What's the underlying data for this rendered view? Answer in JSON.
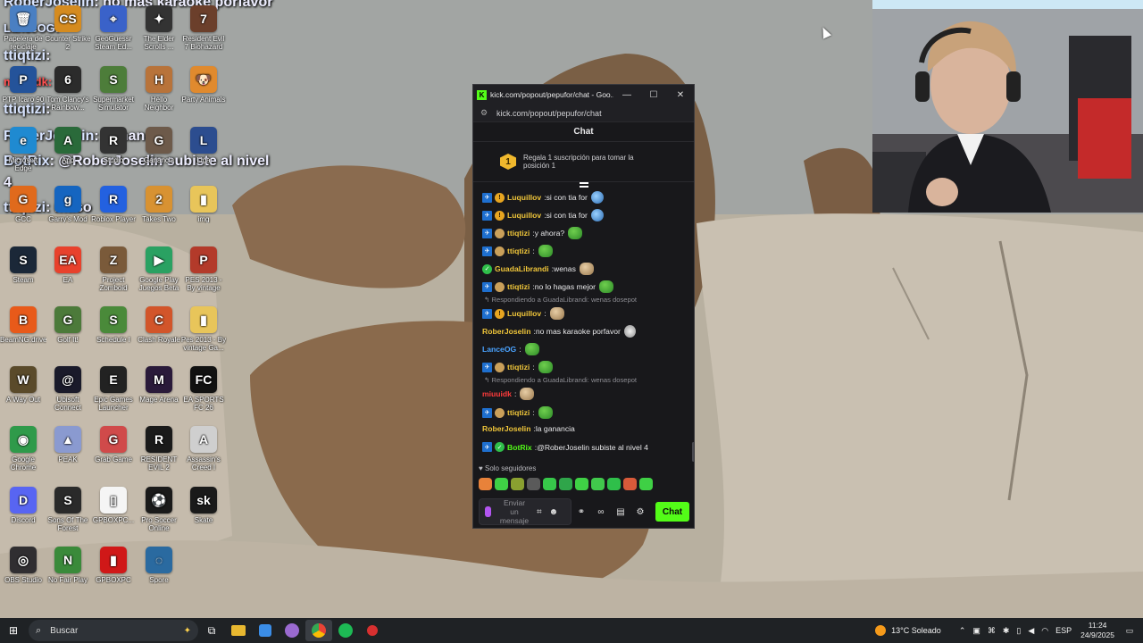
{
  "overlay_chat": [
    {
      "user": "RoberJoselin",
      "text": "no mas karaoke porfavor"
    },
    {
      "user": "LanceOG",
      "text": ""
    },
    {
      "user": "ttiqtizi",
      "text": ""
    },
    {
      "user": "miuuidk",
      "text": ""
    },
    {
      "user": "ttiqtizi",
      "text": ""
    },
    {
      "user": "RoberJoselin",
      "text": "ganancia"
    },
    {
      "user": "BotRix",
      "text": "@RoberJoselin subiste al nivel"
    },
    {
      "user": "",
      "text": "4"
    },
    {
      "user": "ttiqtizi",
      "text": "maso"
    }
  ],
  "desktop_icons": [
    {
      "label": "Papelera de reciclaje",
      "color": "#4a7fc2",
      "glyph": "🗑"
    },
    {
      "label": "Counter Strike 2",
      "color": "#d58b1f",
      "glyph": "CS"
    },
    {
      "label": "GeoGuessr Steam Ed...",
      "color": "#3a62c9",
      "glyph": "⌖"
    },
    {
      "label": "The Elder Scrolls ...",
      "color": "#333333",
      "glyph": "✦"
    },
    {
      "label": "Resident Evil 7 Biohazard",
      "color": "#6b3f2b",
      "glyph": "7"
    },
    {
      "label": "PTP Icaro 90",
      "color": "#24539a",
      "glyph": "P"
    },
    {
      "label": "Tom Clancy's Rainbow...",
      "color": "#2b2b2b",
      "glyph": "6"
    },
    {
      "label": "Supermarket Simulator",
      "color": "#4d7d3a",
      "glyph": "S"
    },
    {
      "label": "Hello Neighbor",
      "color": "#b8733a",
      "glyph": "H"
    },
    {
      "label": "Party Animals",
      "color": "#e08a2e",
      "glyph": "🐶"
    },
    {
      "label": "Microsoft Edge",
      "color": "#1f8ad1",
      "glyph": "e"
    },
    {
      "label": "App",
      "color": "#2a6a3a",
      "glyph": "A"
    },
    {
      "label": "Studio",
      "color": "#333333",
      "glyph": "R"
    },
    {
      "label": "Ganancia",
      "color": "#6d5a4a",
      "glyph": "G"
    },
    {
      "label": "Liga",
      "color": "#2c4d8f",
      "glyph": "L"
    },
    {
      "label": "GCC",
      "color": "#e06a1c",
      "glyph": "G"
    },
    {
      "label": "Garry's Mod",
      "color": "#1565c0",
      "glyph": "g"
    },
    {
      "label": "Roblox Player",
      "color": "#2361e0",
      "glyph": "R"
    },
    {
      "label": "Takes Two",
      "color": "#d89232",
      "glyph": "2"
    },
    {
      "label": "img",
      "color": "#e8c55a",
      "glyph": "▮"
    },
    {
      "label": "Steam",
      "color": "#1b2838",
      "glyph": "S"
    },
    {
      "label": "EA",
      "color": "#e8412c",
      "glyph": "EA"
    },
    {
      "label": "Project Zomboid",
      "color": "#7a5a3a",
      "glyph": "Z"
    },
    {
      "label": "Google Play Juegos Beta",
      "color": "#2aa162",
      "glyph": "▶"
    },
    {
      "label": "PES 2013 - By vintage Ga...",
      "color": "#b33a2a",
      "glyph": "P"
    },
    {
      "label": "BeamNG.drive",
      "color": "#e85a1a",
      "glyph": "B"
    },
    {
      "label": "Golf It!",
      "color": "#4c7a3a",
      "glyph": "G"
    },
    {
      "label": "Schedule I",
      "color": "#4a8a3a",
      "glyph": "S"
    },
    {
      "label": "Clash Royale",
      "color": "#d2552a",
      "glyph": "C"
    },
    {
      "label": "Pes 2013 - By vintage Ga...",
      "color": "#e8c55a",
      "glyph": "▮"
    },
    {
      "label": "A Way Out",
      "color": "#5a4a2a",
      "glyph": "W"
    },
    {
      "label": "Ubisoft Connect",
      "color": "#1a1a2a",
      "glyph": "@"
    },
    {
      "label": "Epic Games Launcher",
      "color": "#222222",
      "glyph": "E"
    },
    {
      "label": "Mage Arena",
      "color": "#2a1a3a",
      "glyph": "M"
    },
    {
      "label": "EA SPORTS FC 26",
      "color": "#111111",
      "glyph": "FC"
    },
    {
      "label": "Google Chrome",
      "color": "#2f9a4a",
      "glyph": "◉"
    },
    {
      "label": "PEAK",
      "color": "#8a9ad0",
      "glyph": "▲"
    },
    {
      "label": "Grab Game",
      "color": "#d04a4a",
      "glyph": "G"
    },
    {
      "label": "RESIDENT EVIL 2",
      "color": "#1a1a1a",
      "glyph": "R"
    },
    {
      "label": "Assassin's Creed I",
      "color": "#cfcfcf",
      "glyph": "A"
    },
    {
      "label": "Discord",
      "color": "#5865f2",
      "glyph": "D"
    },
    {
      "label": "Sons Of The Forest",
      "color": "#2a2a2a",
      "glyph": "S"
    },
    {
      "label": "GPBOXPC...",
      "color": "#f5f5f5",
      "glyph": "▯"
    },
    {
      "label": "Pro Soccer Online",
      "color": "#1a1a1a",
      "glyph": "⚽"
    },
    {
      "label": "Skate",
      "color": "#1a1a1a",
      "glyph": "sk"
    },
    {
      "label": "OBS Studio",
      "color": "#302e31",
      "glyph": "◎"
    },
    {
      "label": "No Fair Play",
      "color": "#3a8a3a",
      "glyph": "N"
    },
    {
      "label": "GPBOXPC",
      "color": "#d01818",
      "glyph": "▮"
    },
    {
      "label": "Spore",
      "color": "#2a6aa0",
      "glyph": "◌"
    }
  ],
  "popup": {
    "title": "kick.com/popout/pepufor/chat - Goo...",
    "url": "kick.com/popout/pepufor/chat",
    "header": "Chat",
    "promo_text": "Regala 1 suscripción para tomar la posición 1",
    "promo_rank": "1",
    "messages": [
      {
        "type": "msg",
        "badges": [
          "bot",
          "sub"
        ],
        "user": "Luquillov",
        "color": "#f0c63a",
        "text": "si con tia for",
        "emote": "globe"
      },
      {
        "type": "msg",
        "badges": [
          "bot",
          "sub"
        ],
        "user": "Luquillov",
        "color": "#f0c63a",
        "text": "si con tia for",
        "emote": "globe"
      },
      {
        "type": "msg",
        "badges": [
          "bot",
          "gift"
        ],
        "user": "ttiqtizi",
        "color": "#f0c63a",
        "text": "y ahora?",
        "emote": "pepe"
      },
      {
        "type": "msg",
        "badges": [
          "bot",
          "gift"
        ],
        "user": "ttiqtizi",
        "color": "#f0c63a",
        "text": "",
        "emote": "pepe"
      },
      {
        "type": "msg",
        "badges": [
          "mod"
        ],
        "user": "GuadaLibrandi",
        "color": "#f0c63a",
        "text": "wenas",
        "emote": "dog"
      },
      {
        "type": "msg",
        "badges": [
          "bot",
          "gift"
        ],
        "user": "ttiqtizi",
        "color": "#f0c63a",
        "text": "no lo hagas mejor",
        "emote": "pepe"
      },
      {
        "type": "reply",
        "text": "Respondiendo a GuadaLibrandi: wenas dosepot"
      },
      {
        "type": "msg",
        "badges": [
          "bot",
          "sub"
        ],
        "user": "Luquillov",
        "color": "#f0c63a",
        "text": "",
        "emote": "dog"
      },
      {
        "type": "msg",
        "badges": [],
        "user": "RoberJoselin",
        "color": "#f0c63a",
        "text": "no mas karaoke porfavor",
        "emote": "skull"
      },
      {
        "type": "msg",
        "badges": [],
        "user": "LanceOG",
        "color": "#4aa3ff",
        "text": "",
        "emote": "pepe"
      },
      {
        "type": "msg",
        "badges": [
          "bot",
          "gift"
        ],
        "user": "ttiqtizi",
        "color": "#f0c63a",
        "text": "",
        "emote": "pepe"
      },
      {
        "type": "reply",
        "text": "Respondiendo a GuadaLibrandi: wenas dosepot"
      },
      {
        "type": "msg",
        "badges": [],
        "user": "miuuidk",
        "color": "#ff3b3b",
        "text": "",
        "emote": "dog"
      },
      {
        "type": "msg",
        "badges": [
          "bot",
          "gift"
        ],
        "user": "ttiqtizi",
        "color": "#f0c63a",
        "text": "",
        "emote": "pepe"
      },
      {
        "type": "msg",
        "badges": [],
        "user": "RoberJoselin",
        "color": "#f0c63a",
        "text": "la ganancia",
        "emote": ""
      },
      {
        "type": "msg",
        "badges": [
          "bot",
          "mod"
        ],
        "user": "BotRix",
        "color": "#53fc18",
        "text": "@RoberJoselin subiste al nivel 4",
        "emote": ""
      }
    ],
    "followers_only": "Solo seguidores",
    "input_placeholder": "Enviar un mensaje",
    "send_label": "Chat",
    "accent": "#53fc18"
  },
  "taskbar": {
    "search_placeholder": "Buscar",
    "weather": "13°C Soleado",
    "lang": "ESP",
    "time": "11:24",
    "date": "24/9/2025"
  }
}
